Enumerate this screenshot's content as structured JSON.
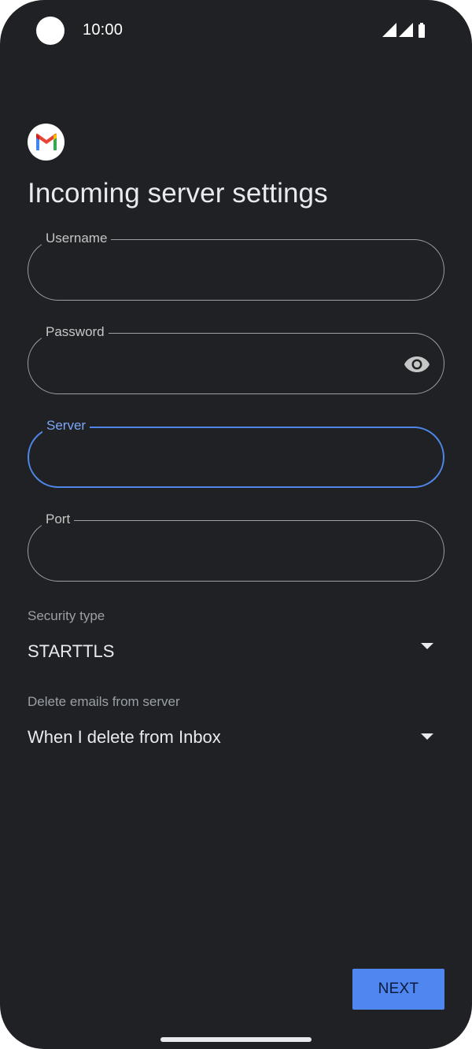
{
  "status_bar": {
    "time": "10:00"
  },
  "page": {
    "title": "Incoming server settings"
  },
  "fields": {
    "username": {
      "label": "Username",
      "value": ""
    },
    "password": {
      "label": "Password",
      "value": ""
    },
    "server": {
      "label": "Server",
      "value": ""
    },
    "port": {
      "label": "Port",
      "value": ""
    }
  },
  "security_type": {
    "label": "Security type",
    "value": "STARTTLS"
  },
  "delete_emails": {
    "label": "Delete emails from server",
    "value": "When I delete from Inbox"
  },
  "actions": {
    "next_label": "NEXT"
  },
  "icons": {
    "app": "gmail-icon",
    "password_toggle": "eye-icon",
    "signal": "signal-icon",
    "wifi": "wifi-icon",
    "battery": "battery-icon",
    "dropdown": "triangle-down-icon"
  },
  "colors": {
    "background": "#202124",
    "accent": "#4f86f0",
    "focus_border": "#4f86e8",
    "field_border": "#9aa0a6",
    "text": "#e8eaed"
  }
}
